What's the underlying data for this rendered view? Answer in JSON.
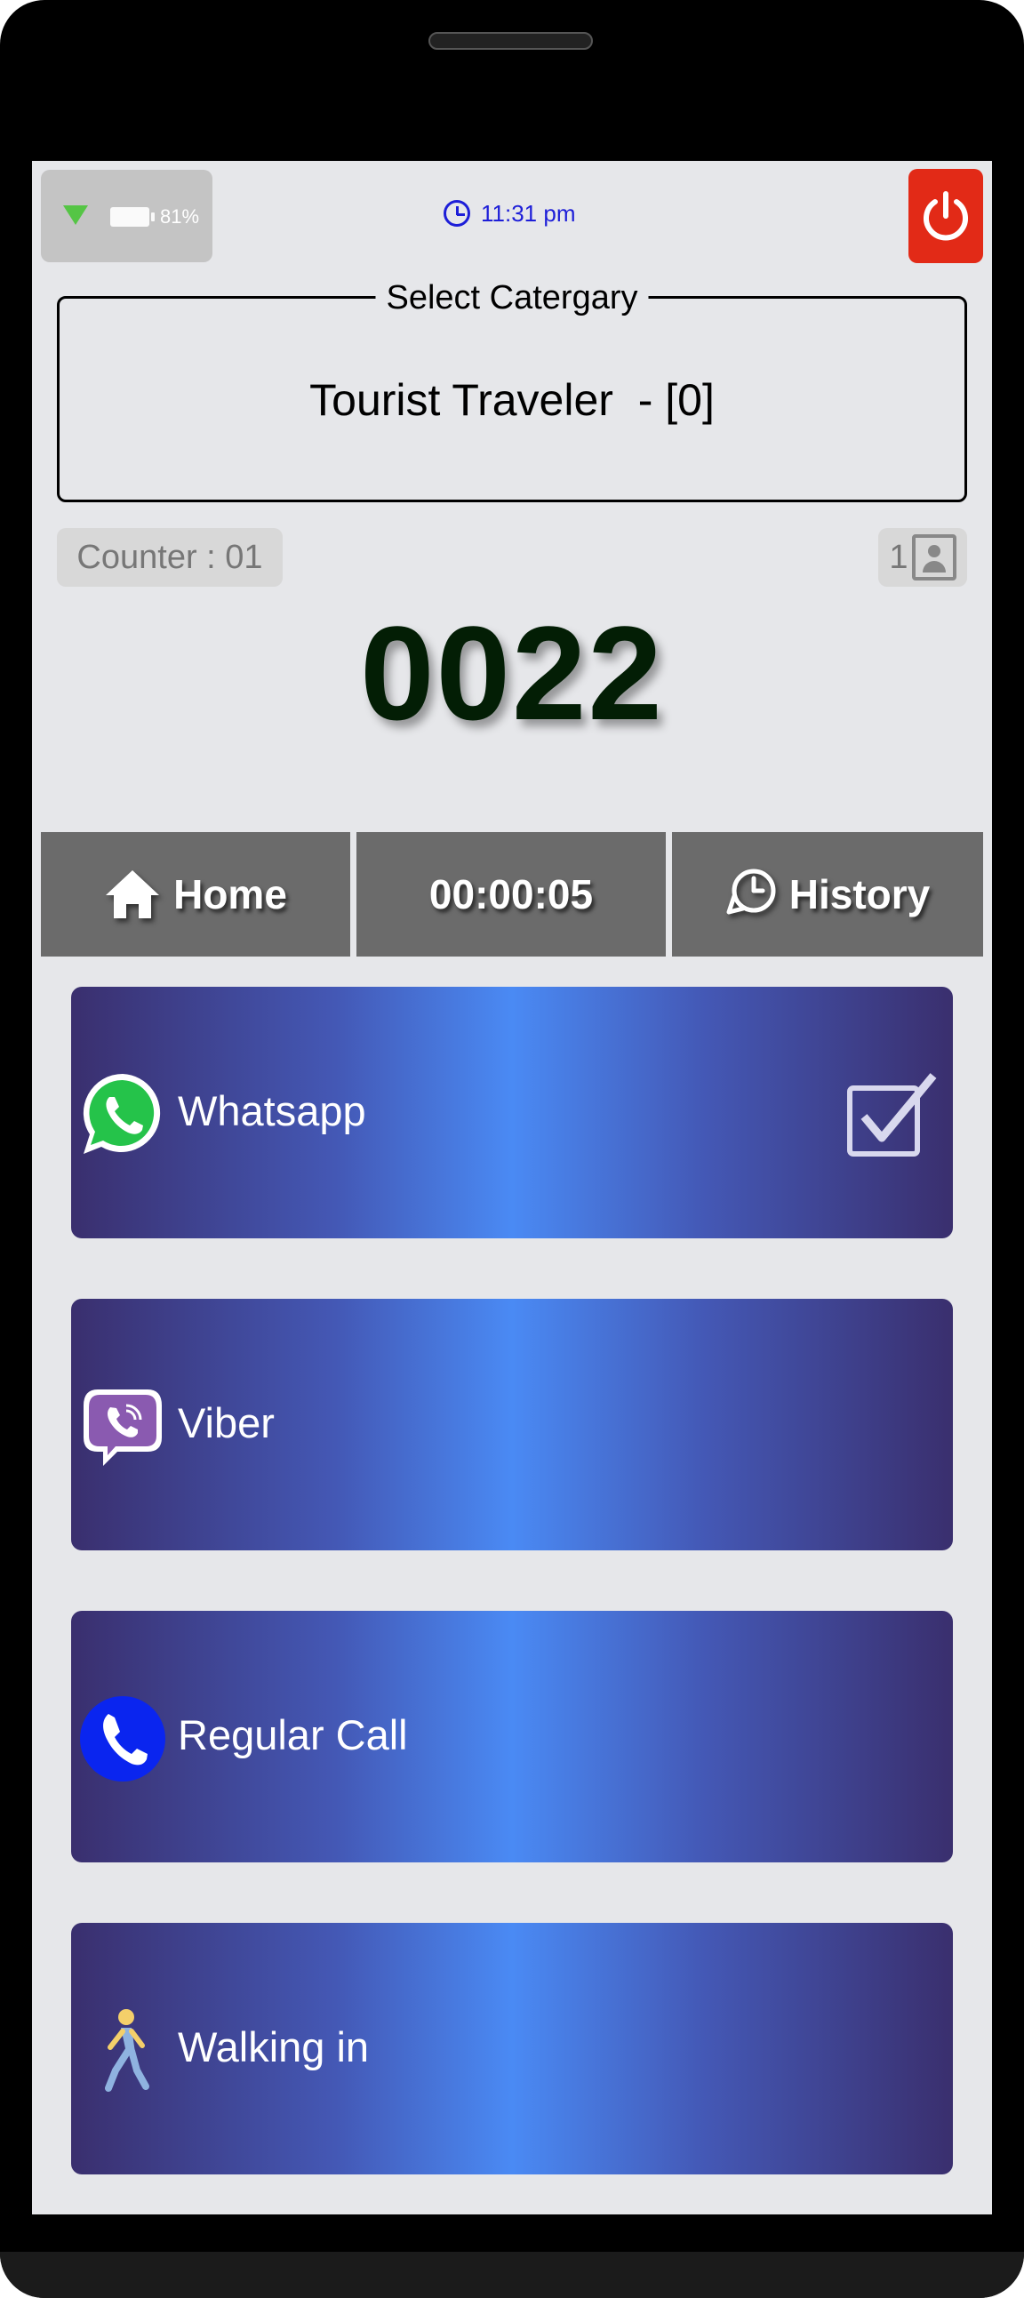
{
  "status_bar": {
    "battery_percent": "81%",
    "time": "11:31 pm"
  },
  "category": {
    "legend": "Select Catergary",
    "value": "Tourist Traveler  - [0]"
  },
  "counter": {
    "label": "Counter : 01",
    "contact_count": "1"
  },
  "ticket_number": "0022",
  "tabs": {
    "home_label": "Home",
    "timer_value": "00:00:05",
    "history_label": "History"
  },
  "options": [
    {
      "label": "Whatsapp",
      "icon": "whatsapp-icon",
      "selected": true
    },
    {
      "label": "Viber",
      "icon": "viber-icon",
      "selected": false
    },
    {
      "label": "Regular Call",
      "icon": "phone-call-icon",
      "selected": false
    },
    {
      "label": "Walking in",
      "icon": "walking-person-icon",
      "selected": false
    }
  ],
  "colors": {
    "power_button": "#e22a17",
    "time_text": "#1d1ed8",
    "ticket_number": "#031e05",
    "tab_background": "#6b6b6b",
    "option_gradient_edge": "#3a2f6e",
    "option_gradient_center": "#4a8af4"
  }
}
